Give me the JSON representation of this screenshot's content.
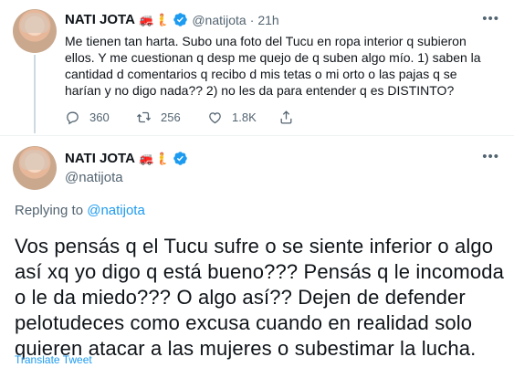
{
  "tweets": [
    {
      "author_name": "NATI JOTA",
      "author_emojis": "🚒🧜",
      "handle": "@natijota",
      "separator": "·",
      "time": "21h",
      "text": "Me tienen tan harta. Subo una foto del Tucu en ropa interior q subieron ellos. Y me cuestionan q desp me quejo de q suben algo mío. 1) saben la cantidad d comentarios q recibo d mis tetas o mi orto o las pajas q se harían y no digo nada?? 2) no les da para entender q es DISTINTO?",
      "replies": "360",
      "retweets": "256",
      "likes": "1.8K"
    },
    {
      "author_name": "NATI JOTA",
      "author_emojis": "🚒🧜",
      "handle": "@natijota",
      "replying_prefix": "Replying to ",
      "replying_to": "@natijota",
      "text": "Vos pensás q el Tucu sufre o se siente inferior o algo así xq yo digo q está bueno??? Pensás q le incomoda o le da miedo??? O algo así?? Dejen de defender pelotudeces como excusa cuando en realidad solo quieren atacar a las mujeres o subestimar la lucha.",
      "translate_label": "Translate Tweet"
    }
  ],
  "icons": {
    "more": "more-icon",
    "verified": "verified-badge-icon",
    "reply": "reply-icon",
    "retweet": "retweet-icon",
    "like": "heart-icon",
    "share": "share-icon"
  },
  "colors": {
    "accent": "#1d9bf0",
    "secondary_text": "#536471",
    "primary_text": "#0f1419",
    "divider": "#eff3f4"
  }
}
